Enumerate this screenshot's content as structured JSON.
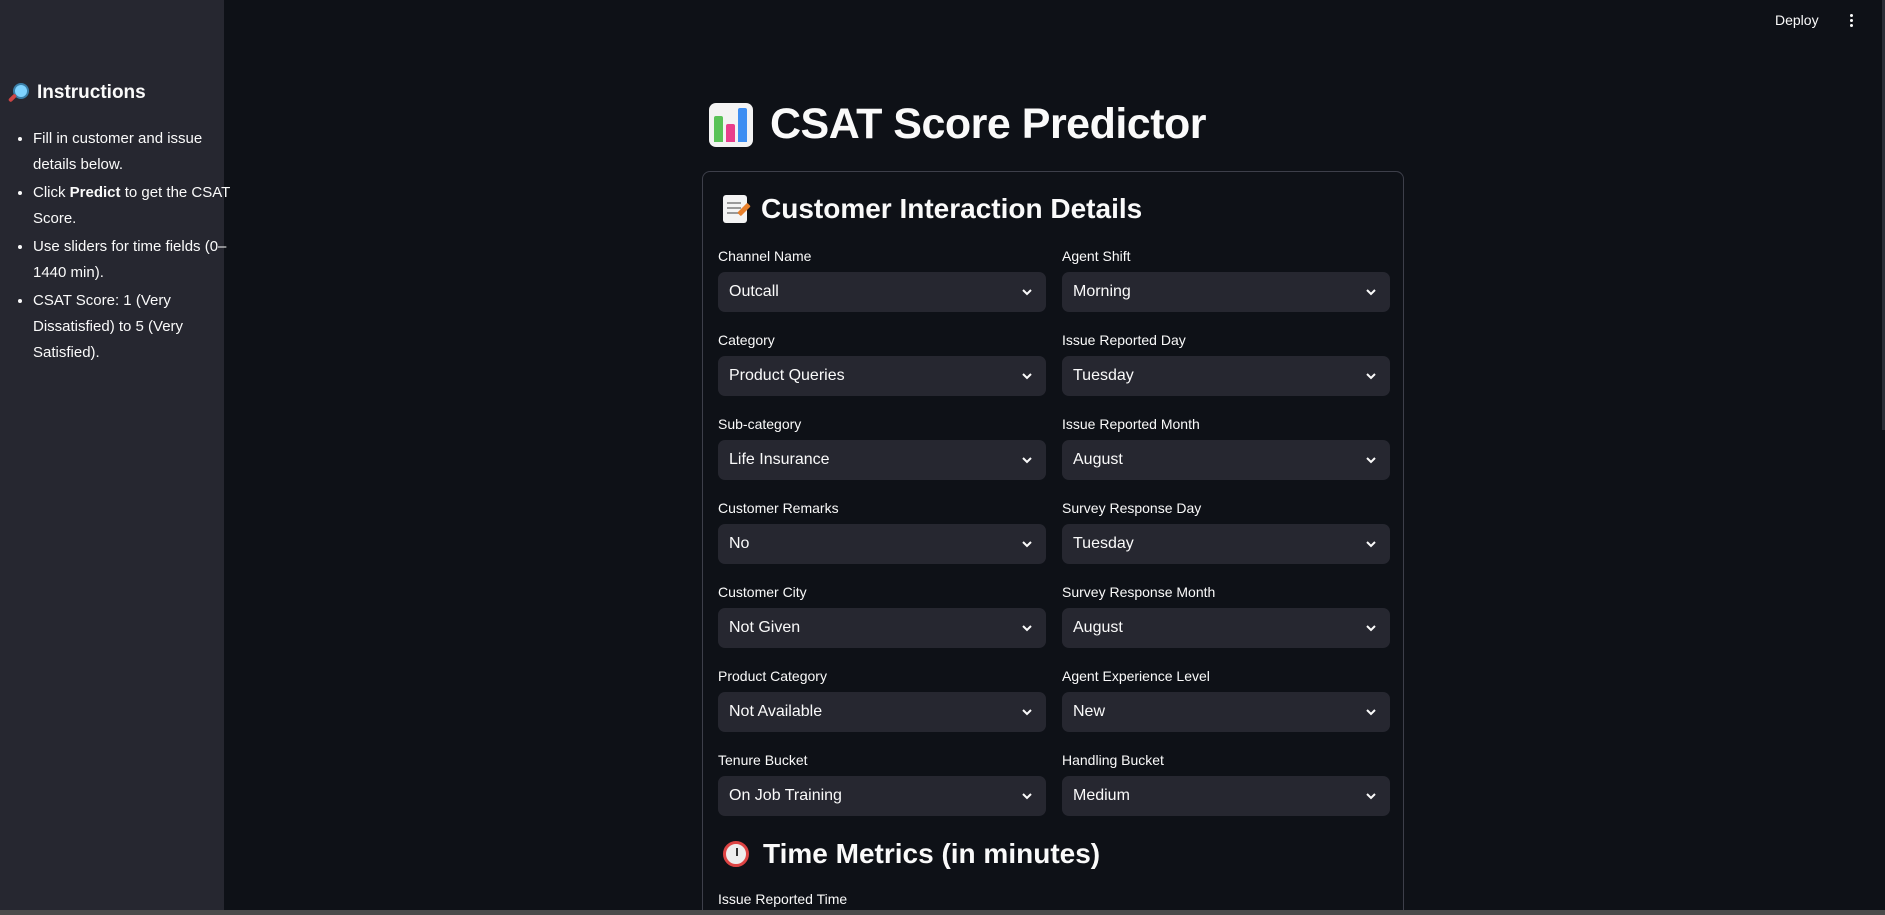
{
  "sidebar": {
    "title": "Instructions",
    "title_icon": "magnifier-icon",
    "items": [
      {
        "pre": "Fill in customer and issue details below.",
        "bold": "",
        "post": ""
      },
      {
        "pre": "Click ",
        "bold": "Predict",
        "post": " to get the CSAT Score."
      },
      {
        "pre": "Use sliders for time fields (0–1440 min).",
        "bold": "",
        "post": ""
      },
      {
        "pre": "CSAT Score: 1 (Very Dissatisfied) to 5 (Very Satisfied).",
        "bold": "",
        "post": ""
      }
    ]
  },
  "topbar": {
    "deploy_label": "Deploy",
    "menu_icon": "vertical-ellipsis-icon"
  },
  "main": {
    "title": "CSAT Score Predictor",
    "title_icon": "bar-chart-icon",
    "section1": {
      "title": "Customer Interaction Details",
      "icon": "memo-icon"
    },
    "fields": {
      "channel_name": {
        "label": "Channel Name",
        "value": "Outcall"
      },
      "agent_shift": {
        "label": "Agent Shift",
        "value": "Morning"
      },
      "category": {
        "label": "Category",
        "value": "Product Queries"
      },
      "issue_reported_day": {
        "label": "Issue Reported Day",
        "value": "Tuesday"
      },
      "sub_category": {
        "label": "Sub-category",
        "value": "Life Insurance"
      },
      "issue_reported_month": {
        "label": "Issue Reported Month",
        "value": "August"
      },
      "customer_remarks": {
        "label": "Customer Remarks",
        "value": "No"
      },
      "survey_response_day": {
        "label": "Survey Response Day",
        "value": "Tuesday"
      },
      "customer_city": {
        "label": "Customer City",
        "value": "Not Given"
      },
      "survey_response_month": {
        "label": "Survey Response Month",
        "value": "August"
      },
      "product_category": {
        "label": "Product Category",
        "value": "Not Available"
      },
      "agent_experience_level": {
        "label": "Agent Experience Level",
        "value": "New"
      },
      "tenure_bucket": {
        "label": "Tenure Bucket",
        "value": "On Job Training"
      },
      "handling_bucket": {
        "label": "Handling Bucket",
        "value": "Medium"
      }
    },
    "section2": {
      "title": "Time Metrics (in minutes)",
      "icon": "stopwatch-icon"
    },
    "issue_reported_time_label": "Issue Reported Time"
  },
  "colors": {
    "background": "#0e1117",
    "sidebar": "#262730",
    "input": "#262730",
    "text": "#fafafa"
  }
}
